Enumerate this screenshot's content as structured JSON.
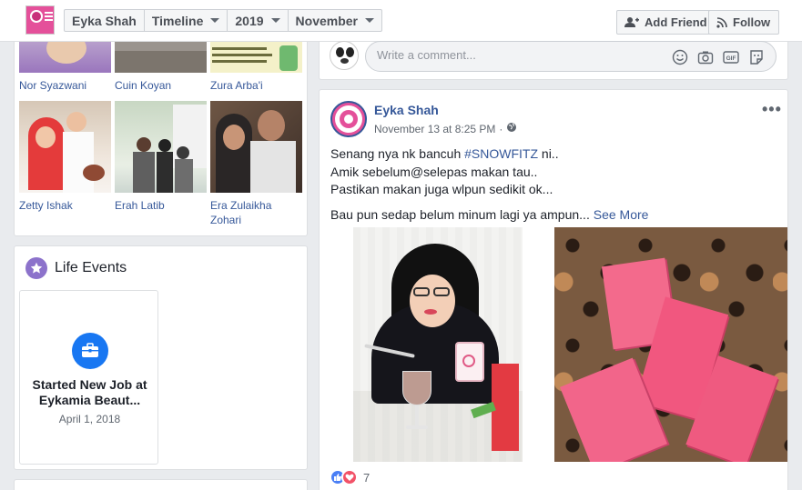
{
  "header": {
    "profile_name": "Eyka Shah",
    "section": "Timeline",
    "year": "2019",
    "month": "November",
    "add_friend_label": "Add Friend",
    "follow_label": "Follow"
  },
  "friends": [
    {
      "name": "Nor Syazwani"
    },
    {
      "name": "Cuin Koyan"
    },
    {
      "name": "Zura Arba'i"
    },
    {
      "name": "Zetty Ishak"
    },
    {
      "name": "Erah Latib"
    },
    {
      "name": "Era Zulaikha Zohari"
    }
  ],
  "life_events": {
    "title": "Life Events",
    "event_title": "Started New Job at Eykamia Beaut...",
    "event_date": "April 1, 2018"
  },
  "comment": {
    "placeholder": "Write a comment...",
    "icons": [
      "emoji-icon",
      "camera-icon",
      "gif-icon",
      "sticker-icon"
    ]
  },
  "post": {
    "author": "Eyka Shah",
    "timestamp": "November 13 at 8:25 PM",
    "audience_icon": "globe-icon",
    "line1_pre": "Senang nya nk bancuh ",
    "line1_tag": "#SNOWFITZ",
    "line1_post": " ni..",
    "line2": "Amik sebelum@selepas makan tau..",
    "line3": "Pastikan makan juga wlpun sedikit ok...",
    "line4": "Bau pun sedap belum minum lagi ya ampun... ",
    "see_more": "See More",
    "reaction_count": "7"
  },
  "colors": {
    "link": "#365899",
    "background": "#e9ebee",
    "like": "#4a7ff5",
    "love": "#f25268",
    "life_event_icon": "#8c72cb",
    "job_icon": "#1877f2"
  }
}
